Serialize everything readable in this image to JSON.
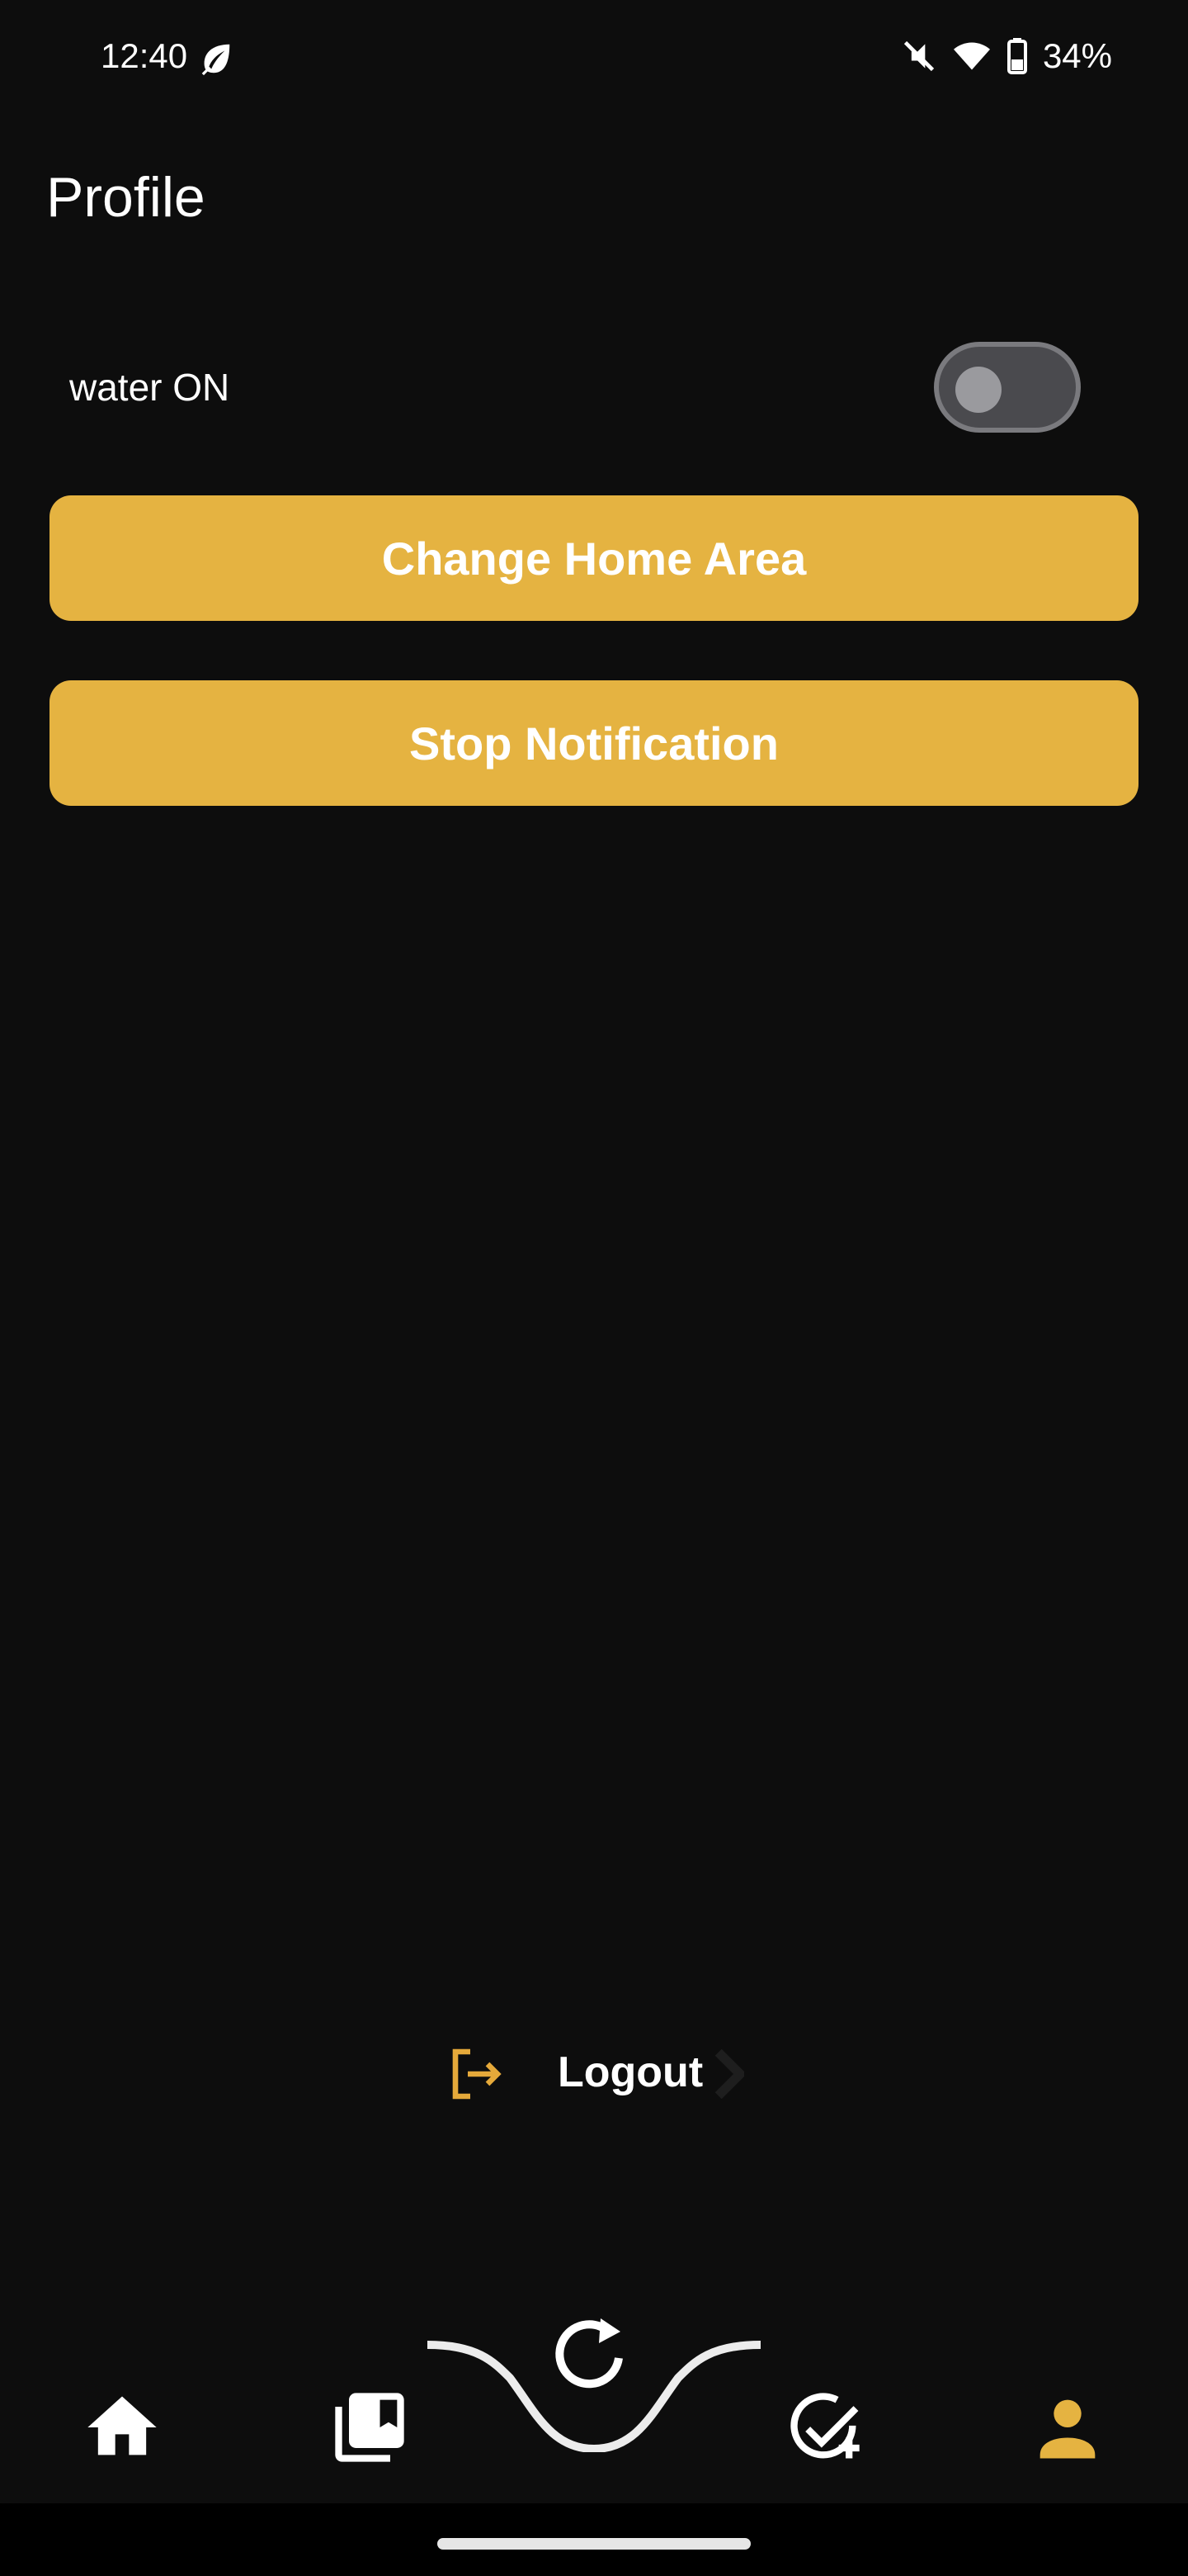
{
  "status_bar": {
    "time": "12:40",
    "battery": "34%",
    "icons": [
      "leaf-icon",
      "mute-icon",
      "wifi-icon",
      "battery-icon"
    ]
  },
  "page": {
    "title": "Profile"
  },
  "settings": {
    "water_label": "water ON",
    "water_toggle_on": false
  },
  "buttons": {
    "change_home_area": "Change Home Area",
    "stop_notification": "Stop Notification"
  },
  "logout": {
    "label": "Logout"
  },
  "bottom_nav": {
    "items": [
      "home-icon",
      "library-icon",
      "refresh-icon",
      "add-task-icon",
      "profile-icon"
    ],
    "active": "profile-icon"
  },
  "colors": {
    "accent": "#e5b341",
    "background": "#0d0d0d",
    "text": "#ffffff"
  }
}
